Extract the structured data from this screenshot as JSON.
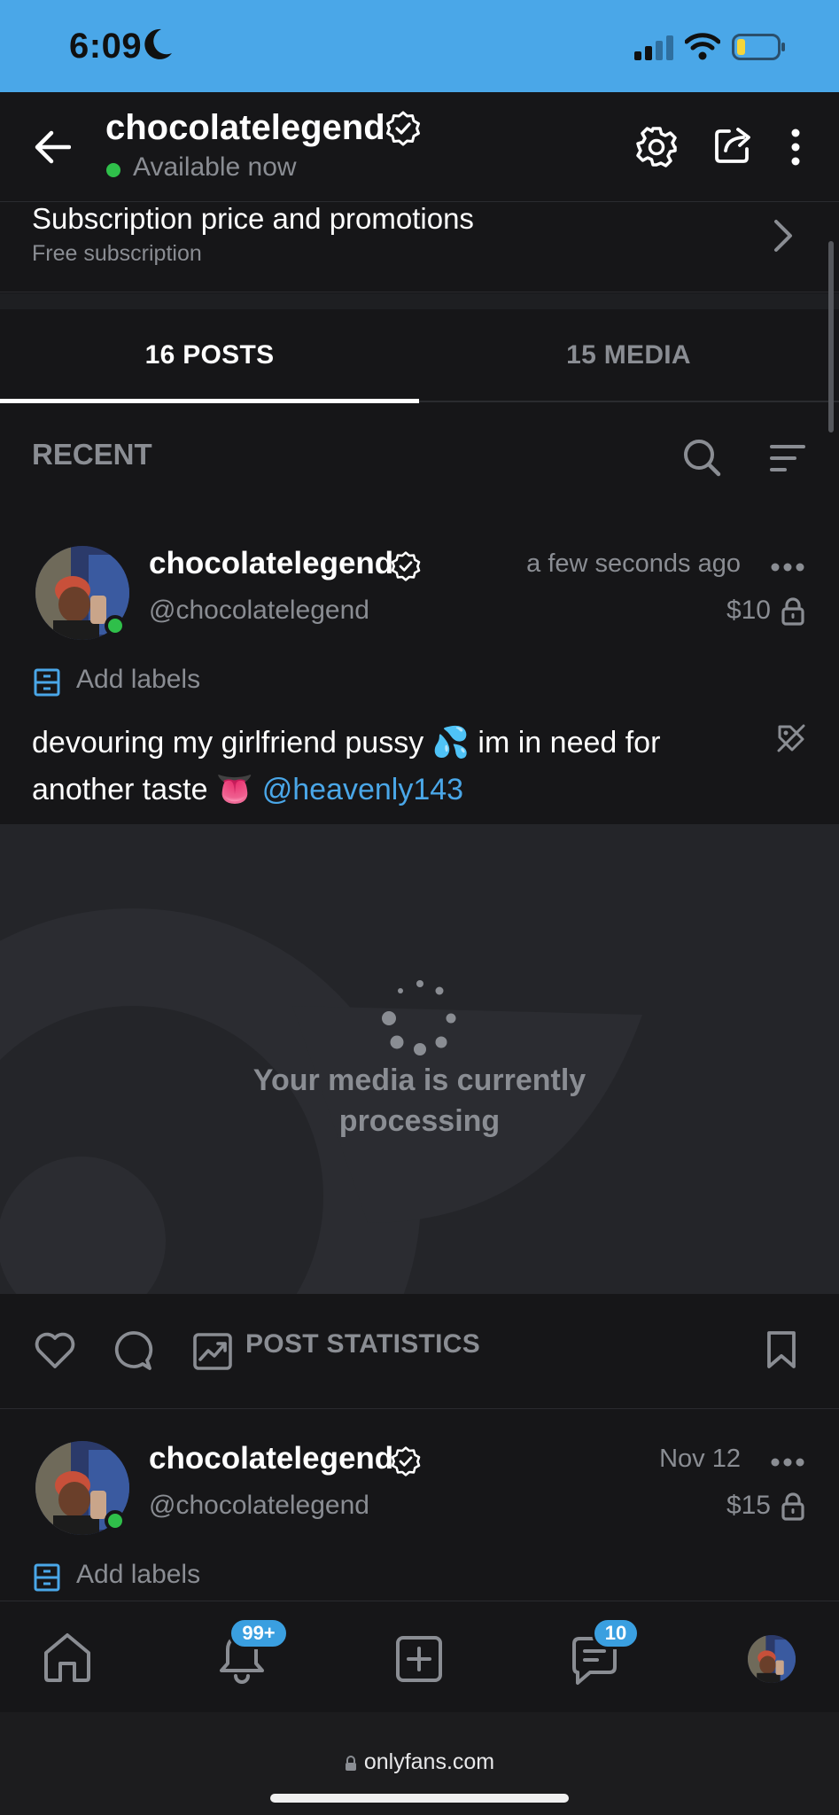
{
  "status_bar": {
    "time": "6:09"
  },
  "header": {
    "name": "chocolatelegend",
    "status": "Available now"
  },
  "subscription": {
    "title": "Subscription price and promotions",
    "value": "Free subscription"
  },
  "tabs": [
    {
      "label": "16 POSTS",
      "active": true
    },
    {
      "label": "15 MEDIA",
      "active": false
    }
  ],
  "section_label": "RECENT",
  "posts": [
    {
      "name": "chocolatelegend",
      "handle": "@chocolatelegend",
      "time": "a few seconds ago",
      "price": "$10",
      "add_labels": "Add labels",
      "text": "devouring my girlfriend pussy 💦 im in need for another taste 👅",
      "mention": "@heavenly143",
      "processing_text_line1": "Your media is currently",
      "processing_text_line2": "processing",
      "stats_label": "POST STATISTICS"
    },
    {
      "name": "chocolatelegend",
      "handle": "@chocolatelegend",
      "time": "Nov 12",
      "price": "$15",
      "add_labels": "Add labels"
    }
  ],
  "bottom_nav": {
    "notifications_badge": "99+",
    "messages_badge": "10"
  },
  "browser": {
    "url": "onlyfans.com"
  },
  "colors": {
    "background": "#161618",
    "status_bar": "#4aa7e8",
    "accent": "#3a9fe0",
    "muted_text": "#8a8d93",
    "online": "#2fbf4a"
  }
}
